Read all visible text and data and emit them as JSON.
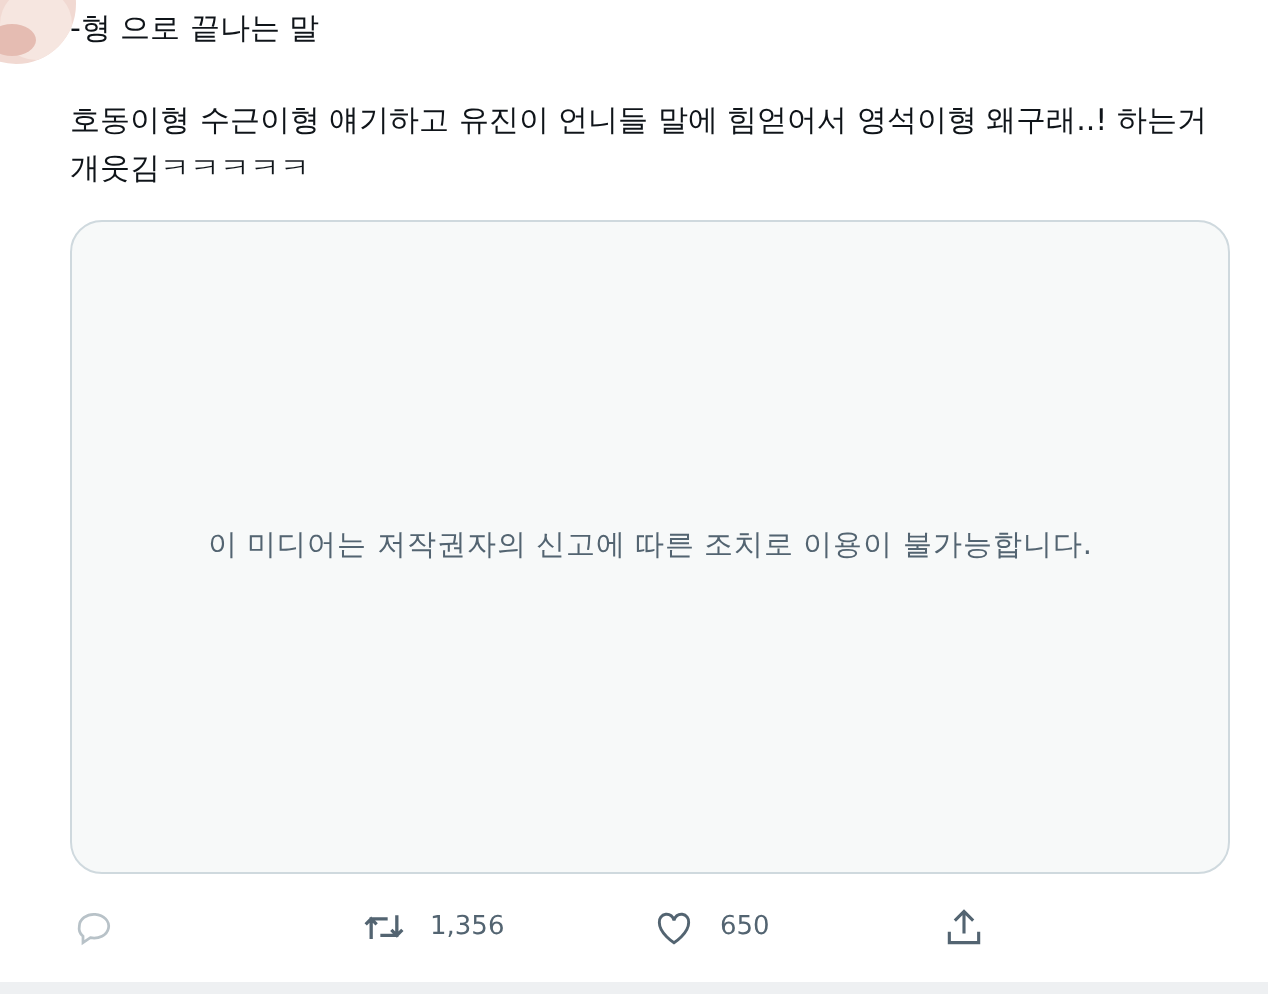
{
  "tweet": {
    "subtitle": "-형 으로 끝나는 말",
    "text": "호동이형 수근이형 얘기하고 유진이 언니들 말에 힘얻어서 영석이형 왜구래..! 하는거 개웃김ㅋㅋㅋㅋㅋ"
  },
  "media": {
    "notice": "이 미디어는 저작권자의 신고에 따른 조치로 이용이 불가능합니다."
  },
  "actions": [
    {
      "kind": "reply"
    },
    {
      "kind": "retweet",
      "count": "1,356"
    },
    {
      "kind": "like",
      "count": "650"
    },
    {
      "kind": "share"
    }
  ]
}
